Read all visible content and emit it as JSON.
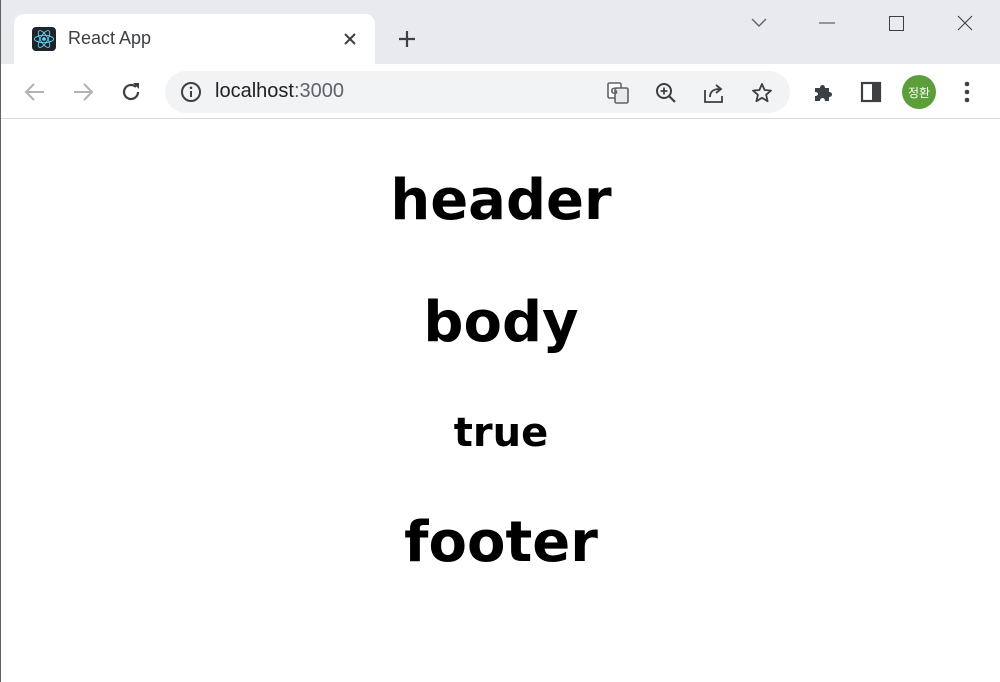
{
  "browser": {
    "tab": {
      "title": "React App",
      "favicon": "react-logo-icon"
    },
    "address_bar": {
      "host": "localhost",
      "port": ":3000"
    },
    "profile": {
      "initials": "정환",
      "color": "#5c9e3a"
    }
  },
  "page": {
    "header": "header",
    "body": "body",
    "flag": "true",
    "footer": "footer"
  }
}
